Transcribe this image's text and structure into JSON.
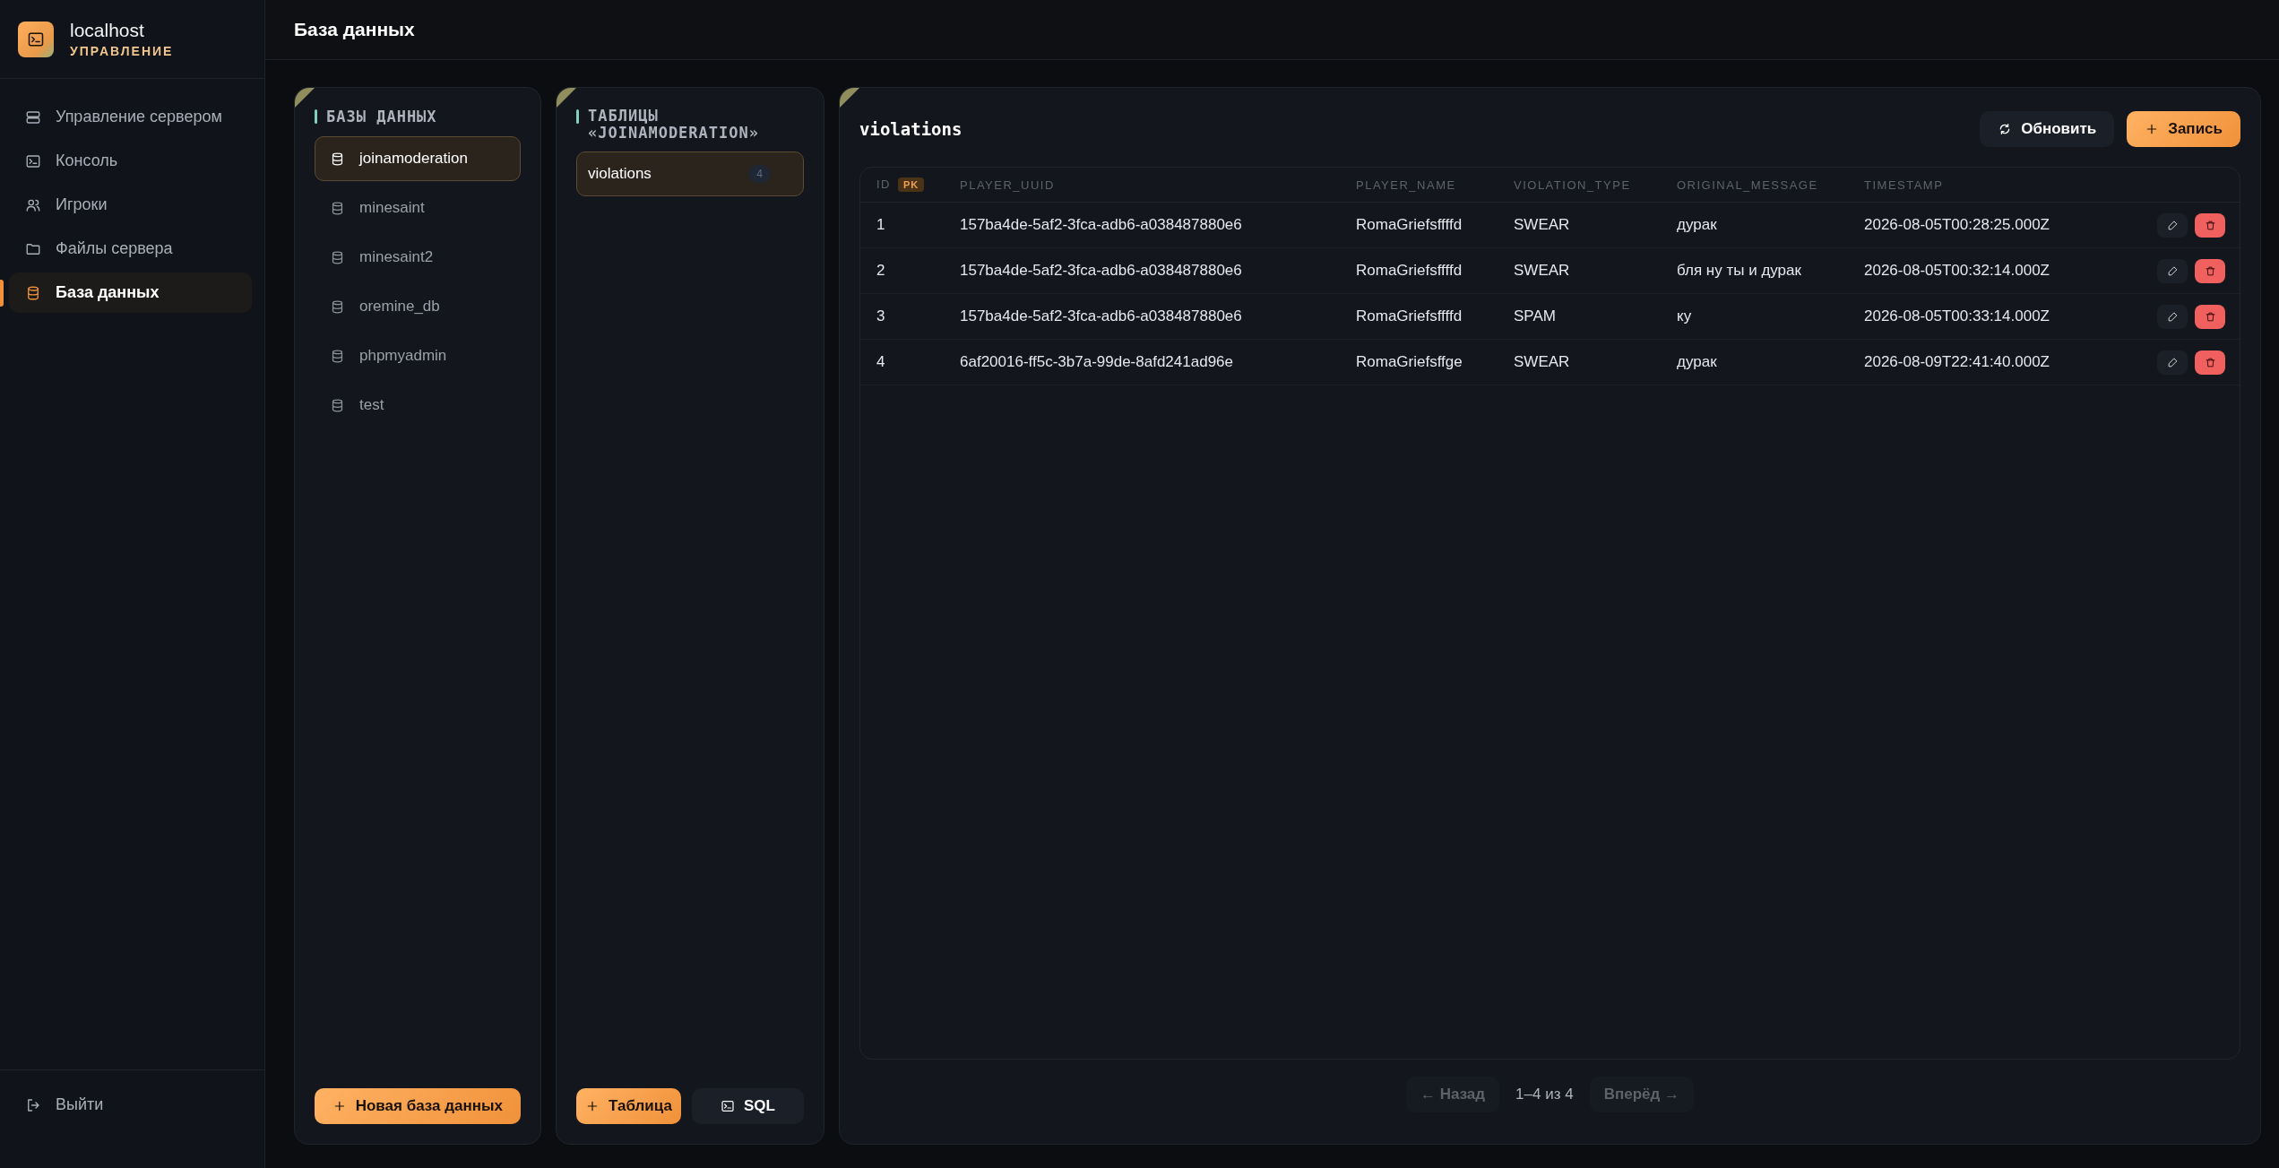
{
  "brand": {
    "title": "localhost",
    "subtitle": "УПРАВЛЕНИЕ"
  },
  "nav": [
    {
      "label": "Управление сервером",
      "kind": "server",
      "selected": false
    },
    {
      "label": "Консоль",
      "kind": "terminal",
      "selected": false
    },
    {
      "label": "Игроки",
      "kind": "users",
      "selected": false
    },
    {
      "label": "Файлы сервера",
      "kind": "folder",
      "selected": false
    },
    {
      "label": "База данных",
      "kind": "database",
      "selected": true
    }
  ],
  "logout": {
    "label": "Выйти"
  },
  "page_title": "База данных",
  "databases": {
    "title": "БАЗЫ ДАННЫХ",
    "items": [
      {
        "name": "joinamoderation",
        "selected": true
      },
      {
        "name": "minesaint",
        "selected": false
      },
      {
        "name": "minesaint2",
        "selected": false
      },
      {
        "name": "oremine_db",
        "selected": false
      },
      {
        "name": "phpmyadmin",
        "selected": false
      },
      {
        "name": "test",
        "selected": false
      }
    ],
    "button": {
      "label": "Новая база данных",
      "kind": "add"
    }
  },
  "tables": {
    "title": "ТАБЛИЦЫ «JOINAMODERATION»",
    "items": [
      {
        "name": "violations",
        "count": "4",
        "selected": true
      }
    ],
    "buttons": [
      {
        "label": "Таблица",
        "kind": "add"
      },
      {
        "label": "SQL",
        "kind": "console"
      }
    ]
  },
  "table_view": {
    "title": "violations",
    "buttons": [
      {
        "label": "Обновить",
        "kind": "refresh"
      },
      {
        "label": "Запись",
        "kind": "add"
      }
    ],
    "columns": [
      {
        "label": "ID",
        "badge": "PK"
      },
      {
        "label": "PLAYER_UUID"
      },
      {
        "label": "PLAYER_NAME"
      },
      {
        "label": "VIOLATION_TYPE"
      },
      {
        "label": "ORIGINAL_MESSAGE"
      },
      {
        "label": "TIMESTAMP"
      }
    ],
    "rows": [
      [
        "1",
        "157ba4de-5af2-3fca-adb6-a038487880e6",
        "RomaGriefsffffd",
        "SWEAR",
        "дурак",
        "2026-08-05T00:28:25.000Z"
      ],
      [
        "2",
        "157ba4de-5af2-3fca-adb6-a038487880e6",
        "RomaGriefsffffd",
        "SWEAR",
        "бля ну ты и дурак",
        "2026-08-05T00:32:14.000Z"
      ],
      [
        "3",
        "157ba4de-5af2-3fca-adb6-a038487880e6",
        "RomaGriefsffffd",
        "SPAM",
        "ку",
        "2026-08-05T00:33:14.000Z"
      ],
      [
        "4",
        "6af20016-ff5c-3b7a-99de-8afd241ad96e",
        "RomaGriefsffge",
        "SWEAR",
        "дурак",
        "2026-08-09T22:41:40.000Z"
      ]
    ],
    "pagination": {
      "prev": {
        "label": "← Назад",
        "disabled": true
      },
      "info": "1–4 из 4",
      "next": {
        "label": "Вперёд →",
        "disabled": true
      }
    }
  }
}
